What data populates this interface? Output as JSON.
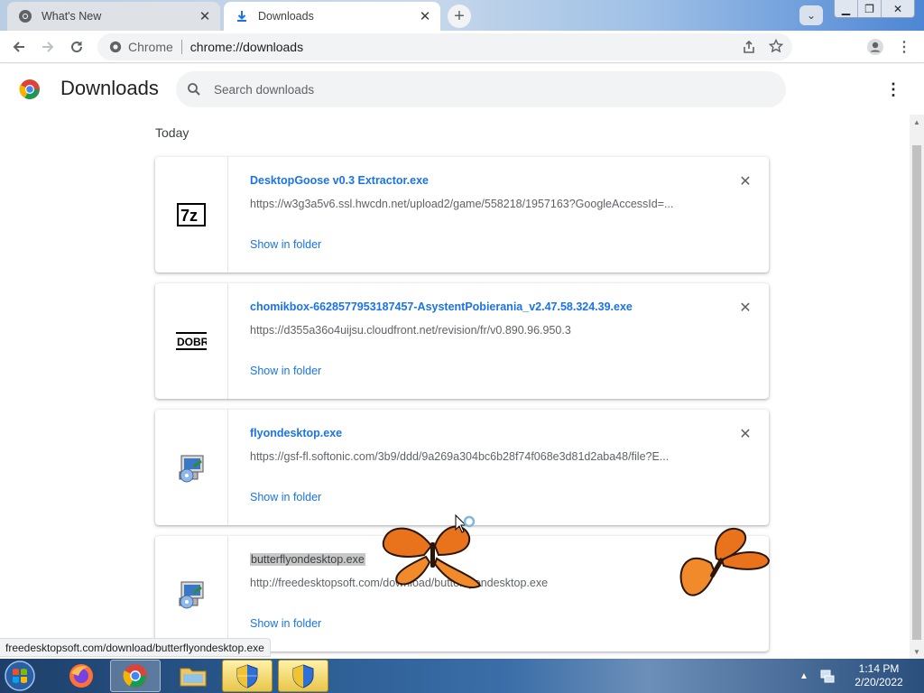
{
  "tabs": [
    {
      "title": "What's New",
      "active": false,
      "icon": "chrome-icon"
    },
    {
      "title": "Downloads",
      "active": true,
      "icon": "download-icon"
    }
  ],
  "window_controls": [
    "minimize",
    "restore",
    "close"
  ],
  "omnibox": {
    "site_label": "Chrome",
    "url": "chrome://downloads"
  },
  "header": {
    "title": "Downloads",
    "search_placeholder": "Search downloads"
  },
  "day_label": "Today",
  "downloads": [
    {
      "filename": "DesktopGoose v0.3 Extractor.exe",
      "url": "https://w3g3a5v6.ssl.hwcdn.net/upload2/game/558218/1957163?GoogleAccessId=...",
      "action": "Show in folder",
      "icon": "7zip-icon",
      "removable": true
    },
    {
      "filename": "chomikbox-6628577953187457-AsystentPobierania_v2.47.58.324.39.exe",
      "url": "https://d355a36o4uijsu.cloudfront.net/revision/fr/v0.890.96.950.3",
      "action": "Show in folder",
      "icon": "dobre-icon",
      "removable": true
    },
    {
      "filename": "flyondesktop.exe",
      "url": "https://gsf-fl.softonic.com/3b9/ddd/9a269a304bc6b28f74f068e3d81d2aba48/file?E...",
      "action": "Show in folder",
      "icon": "installer-icon",
      "removable": true
    },
    {
      "filename": "butterflyondesktop.exe",
      "url": "http://freedesktopsoft.com/download/butterflyondesktop.exe",
      "action": "Show in folder",
      "icon": "installer-icon",
      "removable": false
    }
  ],
  "status_bubble": "freedesktopsoft.com/download/butterflyondesktop.exe",
  "clock": {
    "time": "1:14 PM",
    "date": "2/20/2022"
  },
  "colors": {
    "link": "#1a73e8",
    "tab_bg": "#dee1e6",
    "taskbar": "#2a5a8f"
  }
}
